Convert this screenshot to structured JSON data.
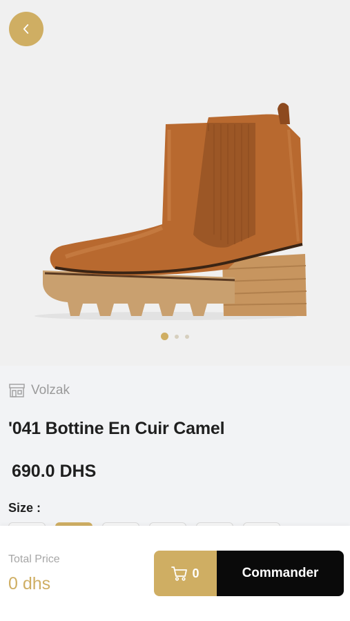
{
  "header": {
    "back_icon": "chevron-left-icon"
  },
  "gallery": {
    "image_count": 3,
    "active_index": 0
  },
  "product": {
    "store_icon": "store-icon",
    "store_name": "Volzak",
    "title": "'041 Bottine En Cuir Camel",
    "price": "690.0 DHS",
    "size_label": "Size :",
    "size_options_visible": 6,
    "selected_size_index": 1
  },
  "bottom_bar": {
    "total_label": "Total Price",
    "total_value": "0 dhs",
    "cart_icon": "cart-icon",
    "cart_count": "0",
    "order_label": "Commander"
  },
  "colors": {
    "accent": "#cfae63",
    "dark": "#0a0a0a",
    "text": "#1f1f1f"
  }
}
